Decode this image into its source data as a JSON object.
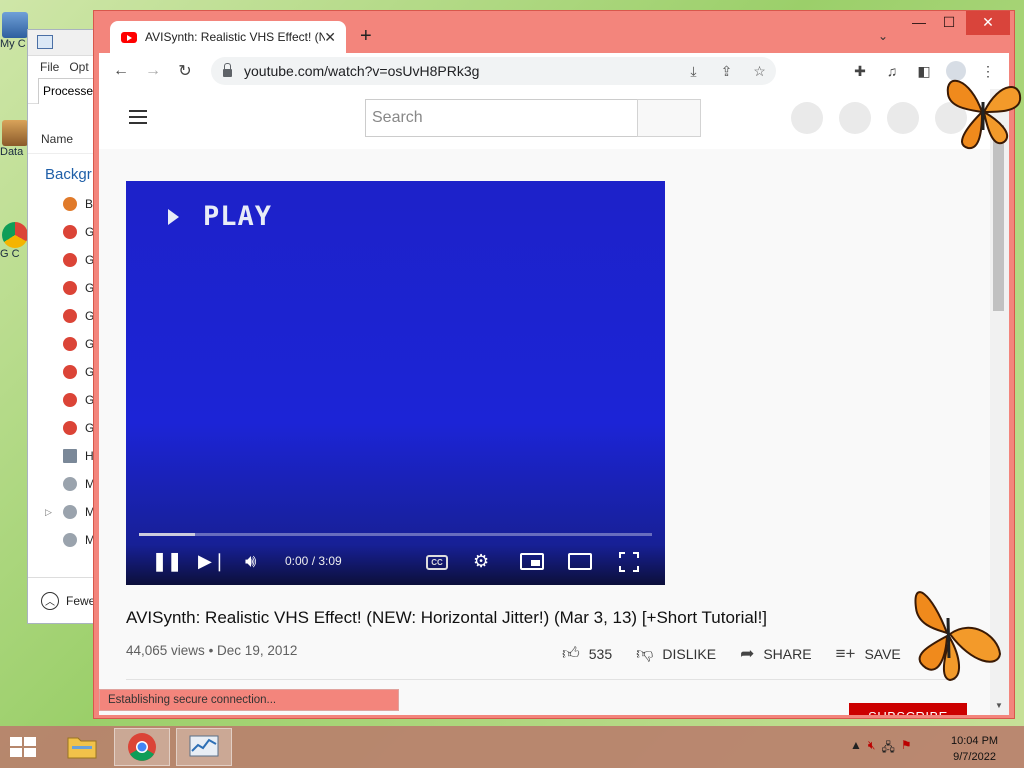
{
  "desktop": {
    "icons": [
      {
        "label": "My C",
        "name": "my-computer"
      },
      {
        "label": "Data",
        "name": "data"
      },
      {
        "label": "G\nC",
        "name": "google-chrome"
      }
    ]
  },
  "taskmgr": {
    "menu": [
      "File",
      "Opt"
    ],
    "tab": "Processes",
    "column": "Name",
    "group": "Backgr",
    "rows": [
      "B",
      "G",
      "G",
      "G",
      "G",
      "G",
      "G",
      "G",
      "G",
      "H",
      "M",
      "M",
      "M"
    ],
    "footer": "Fewe"
  },
  "browser": {
    "tab_title": "AVISynth: Realistic VHS Effect! (N",
    "tab_close": "✕",
    "new_tab": "+",
    "url": "youtube.com/watch?v=osUvH8PRk3g",
    "window_controls": {
      "minimize": "—",
      "maximize": "☐",
      "close": "✕"
    },
    "status_text": "Establishing secure connection..."
  },
  "youtube": {
    "search_placeholder": "Search",
    "player": {
      "overlay_text": "PLAY",
      "time": "0:00 / 3:09",
      "progress_fraction": 0.11,
      "cc_label": "CC"
    },
    "video_title": "AVISynth: Realistic VHS Effect! (NEW: Horizontal Jitter!) (Mar 3, 13) [+Short Tutorial!]",
    "views": "44,065 views",
    "date": "Dec 19, 2012",
    "meta_sep": " • ",
    "likes": "535",
    "dislike_label": "DISLIKE",
    "share_label": "SHARE",
    "save_label": "SAVE",
    "subscribe_label": "SUBSCRIBE"
  },
  "taskbar": {
    "clock_time": "10:04 PM",
    "clock_date": "9/7/2022"
  },
  "colors": {
    "window_frame": "#f3857c",
    "player_blue": "#1c24d6",
    "subscribe_red": "#cc0000"
  }
}
